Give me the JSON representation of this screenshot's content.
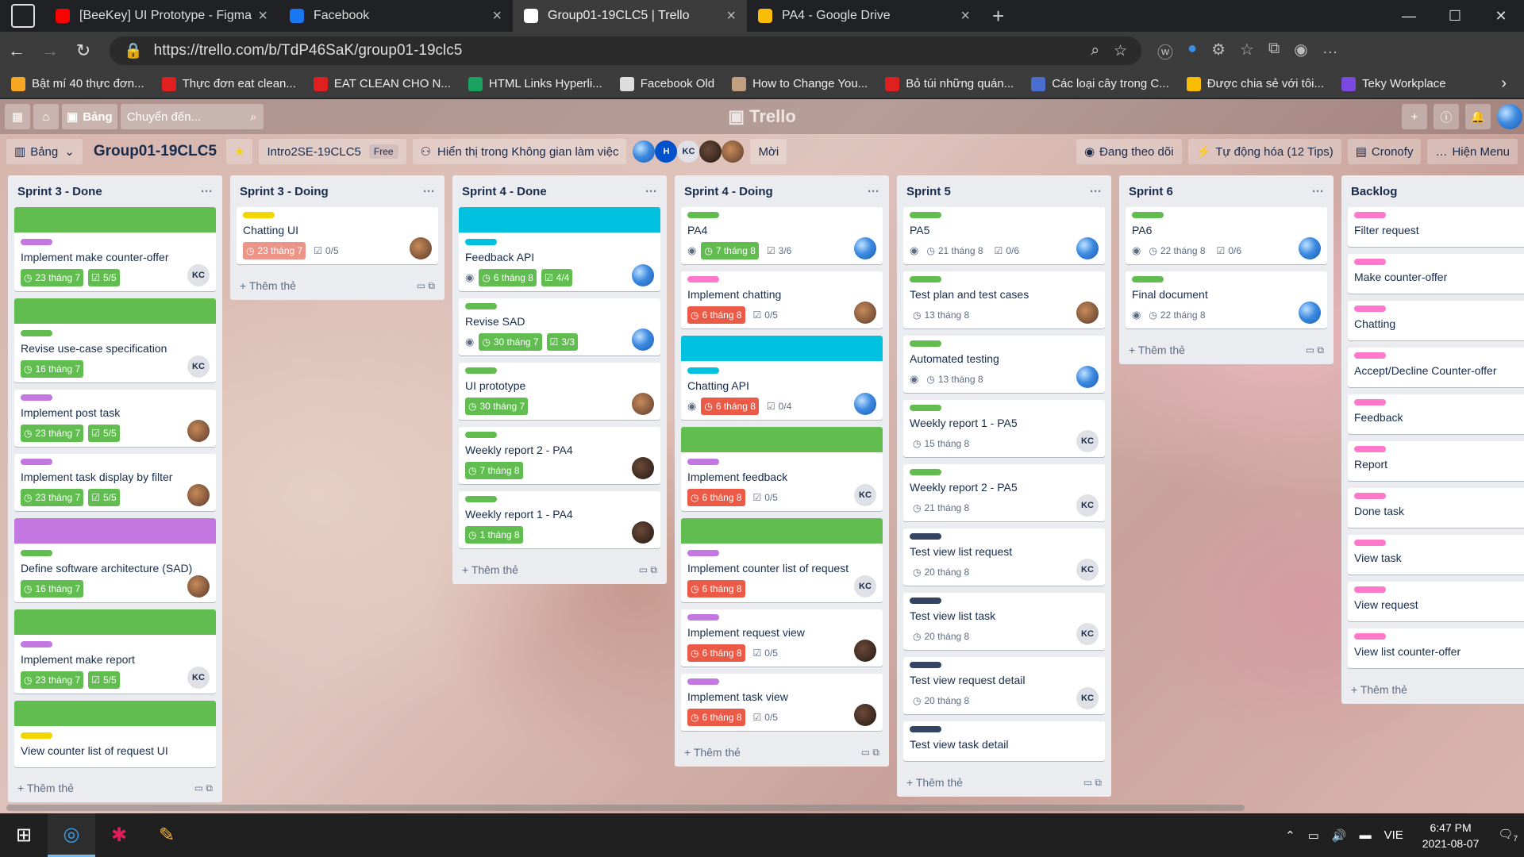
{
  "browser": {
    "tabs": [
      {
        "title": "[BeeKey] UI Prototype - Figma - YouTube",
        "icon": "youtube-icon",
        "color": "#ff0000"
      },
      {
        "title": "Facebook",
        "icon": "facebook-icon",
        "color": "#1877f2"
      },
      {
        "title": "Group01-19CLC5 | Trello",
        "icon": "trello-icon",
        "color": "#ffffff"
      },
      {
        "title": "PA4 - Google Drive",
        "icon": "google-drive-icon",
        "color": "#fbbc04"
      }
    ],
    "url": "https://trello.com/b/TdP46SaK/group01-19clc5",
    "bookmarks": [
      {
        "label": "Bật mí 40 thực đơn...",
        "color": "#f5a623"
      },
      {
        "label": "Thực đơn eat clean...",
        "color": "#e02020"
      },
      {
        "label": "EAT CLEAN CHO N...",
        "color": "#e02020"
      },
      {
        "label": "HTML Links Hyperli...",
        "color": "#1aa260"
      },
      {
        "label": "Facebook Old",
        "color": "#dddddd"
      },
      {
        "label": "How to Change You...",
        "color": "#c0a080"
      },
      {
        "label": "Bỏ túi những quán...",
        "color": "#e02020"
      },
      {
        "label": "Các loại cây trong C...",
        "color": "#4a6fd0"
      },
      {
        "label": "Được chia sẻ với tôi...",
        "color": "#fbbc04"
      },
      {
        "label": "Teky Workplace",
        "color": "#7a4ae0"
      }
    ]
  },
  "trello": {
    "nav_board": "Bảng",
    "search_placeholder": "Chuyển đến...",
    "logo": "Trello",
    "board_view": "Bảng",
    "board_title": "Group01-19CLC5",
    "workspace": "Intro2SE-19CLC5",
    "workspace_plan": "Free",
    "visibility": "Hiển thị trong Không gian làm việc",
    "member_kc": "KC",
    "member_h": "H",
    "invite": "Mời",
    "following": "Đang theo dõi",
    "automation": "Tự động hóa (12 Tips)",
    "cronofy": "Cronofy",
    "menu": "Hiện Menu",
    "add_card": "Thêm thẻ"
  },
  "lists": [
    {
      "name": "Sprint 3 - Done",
      "cards": [
        {
          "cover": "#61bd4f",
          "label": "#c377e0",
          "title": "Implement make counter-offer",
          "due": "23 tháng 7",
          "check": "5/5",
          "member": "KC"
        },
        {
          "cover": "#61bd4f",
          "label": "#61bd4f",
          "title": "Revise use-case specification",
          "due": "16 tháng 7",
          "member": "KC"
        },
        {
          "label": "#c377e0",
          "title": "Implement post task",
          "due": "23 tháng 7",
          "check": "5/5",
          "member": "photo"
        },
        {
          "label": "#c377e0",
          "title": "Implement task display by filter",
          "due": "23 tháng 7",
          "check": "5/5",
          "member": "photo"
        },
        {
          "cover": "#c377e0",
          "label": "#61bd4f",
          "title": "Define software architecture (SAD)",
          "due": "16 tháng 7",
          "member": "photo"
        },
        {
          "cover": "#61bd4f",
          "label": "#c377e0",
          "title": "Implement make report",
          "due": "23 tháng 7",
          "check": "5/5",
          "member": "KC"
        },
        {
          "cover": "#61bd4f",
          "label": "#f2d600",
          "title": "View counter list of request UI"
        }
      ]
    },
    {
      "name": "Sprint 3 - Doing",
      "cards": [
        {
          "label": "#f2d600",
          "title": "Chatting UI",
          "due": "23 tháng 7",
          "due_style": "pink",
          "check": "0/5",
          "check_style": "plain",
          "member": "photo"
        }
      ]
    },
    {
      "name": "Sprint 4 - Done",
      "cards": [
        {
          "cover": "#00c2e0",
          "label": "#00c2e0",
          "title": "Feedback API",
          "watch": true,
          "due": "6 tháng 8",
          "check": "4/4",
          "member": "blue"
        },
        {
          "label": "#61bd4f",
          "title": "Revise SAD",
          "watch": true,
          "due": "30 tháng 7",
          "check": "3/3",
          "member": "blue"
        },
        {
          "label": "#61bd4f",
          "title": "UI prototype",
          "due": "30 tháng 7",
          "member": "photo"
        },
        {
          "label": "#61bd4f",
          "title": "Weekly report 2 - PA4",
          "due": "7 tháng 8",
          "member": "dark"
        },
        {
          "label": "#61bd4f",
          "title": "Weekly report 1 - PA4",
          "due": "1 tháng 8",
          "member": "dark"
        }
      ]
    },
    {
      "name": "Sprint 4 - Doing",
      "cards": [
        {
          "label": "#61bd4f",
          "title": "PA4",
          "watch": true,
          "due": "7 tháng 8",
          "check": "3/6",
          "check_style": "plain",
          "member": "blue"
        },
        {
          "label": "#ff78cb",
          "title": "Implement chatting",
          "due": "6 tháng 8",
          "due_style": "red",
          "check": "0/5",
          "check_style": "plain",
          "member": "photo"
        },
        {
          "cover": "#00c2e0",
          "label": "#00c2e0",
          "title": "Chatting API",
          "watch": true,
          "due": "6 tháng 8",
          "due_style": "red",
          "check": "0/4",
          "check_style": "plain",
          "member": "blue"
        },
        {
          "cover": "#61bd4f",
          "label": "#c377e0",
          "title": "Implement feedback",
          "due": "6 tháng 8",
          "due_style": "red",
          "check": "0/5",
          "check_style": "plain",
          "member": "KC"
        },
        {
          "cover": "#61bd4f",
          "label": "#c377e0",
          "title": "Implement counter list of request",
          "due": "6 tháng 8",
          "due_style": "red",
          "member": "KC"
        },
        {
          "label": "#c377e0",
          "title": "Implement request view",
          "due": "6 tháng 8",
          "due_style": "red",
          "check": "0/5",
          "check_style": "plain",
          "member": "dark"
        },
        {
          "label": "#c377e0",
          "title": "Implement task view",
          "due": "6 tháng 8",
          "due_style": "red",
          "check": "0/5",
          "check_style": "plain",
          "member": "dark"
        }
      ]
    },
    {
      "name": "Sprint 5",
      "cards": [
        {
          "label": "#61bd4f",
          "title": "PA5",
          "watch": true,
          "due": "21 tháng 8",
          "due_style": "plain",
          "check": "0/6",
          "check_style": "plain",
          "member": "blue"
        },
        {
          "label": "#61bd4f",
          "title": "Test plan and test cases",
          "due": "13 tháng 8",
          "due_style": "plain",
          "member": "photo"
        },
        {
          "label": "#61bd4f",
          "title": "Automated testing",
          "watch": true,
          "due": "13 tháng 8",
          "due_style": "plain",
          "member": "blue"
        },
        {
          "label": "#61bd4f",
          "title": "Weekly report 1 - PA5",
          "due": "15 tháng 8",
          "due_style": "plain",
          "member": "KC"
        },
        {
          "label": "#61bd4f",
          "title": "Weekly report 2 - PA5",
          "due": "21 tháng 8",
          "due_style": "plain",
          "member": "KC"
        },
        {
          "label": "#344563",
          "title": "Test view list request",
          "due": "20 tháng 8",
          "due_style": "plain",
          "member": "KC"
        },
        {
          "label": "#344563",
          "title": "Test view list task",
          "due": "20 tháng 8",
          "due_style": "plain",
          "member": "KC"
        },
        {
          "label": "#344563",
          "title": "Test view request detail",
          "due": "20 tháng 8",
          "due_style": "plain",
          "member": "KC"
        },
        {
          "label": "#344563",
          "title": "Test view task detail"
        }
      ]
    },
    {
      "name": "Sprint 6",
      "cards": [
        {
          "label": "#61bd4f",
          "title": "PA6",
          "watch": true,
          "due": "22 tháng 8",
          "due_style": "plain",
          "check": "0/6",
          "check_style": "plain",
          "member": "blue"
        },
        {
          "label": "#61bd4f",
          "title": "Final document",
          "watch": true,
          "due": "22 tháng 8",
          "due_style": "plain",
          "member": "blue"
        }
      ]
    },
    {
      "name": "Backlog",
      "cards": [
        {
          "label": "#ff78cb",
          "title": "Filter request"
        },
        {
          "label": "#ff78cb",
          "title": "Make counter-offer"
        },
        {
          "label": "#ff78cb",
          "title": "Chatting"
        },
        {
          "label": "#ff78cb",
          "title": "Accept/Decline Counter-offer"
        },
        {
          "label": "#ff78cb",
          "title": "Feedback"
        },
        {
          "label": "#ff78cb",
          "title": "Report"
        },
        {
          "label": "#ff78cb",
          "title": "Done task"
        },
        {
          "label": "#ff78cb",
          "title": "View task"
        },
        {
          "label": "#ff78cb",
          "title": "View request"
        },
        {
          "label": "#ff78cb",
          "title": "View list counter-offer"
        }
      ]
    }
  ],
  "taskbar": {
    "language": "VIE",
    "time": "6:47 PM",
    "date": "2021-08-07",
    "notifications": "7"
  }
}
